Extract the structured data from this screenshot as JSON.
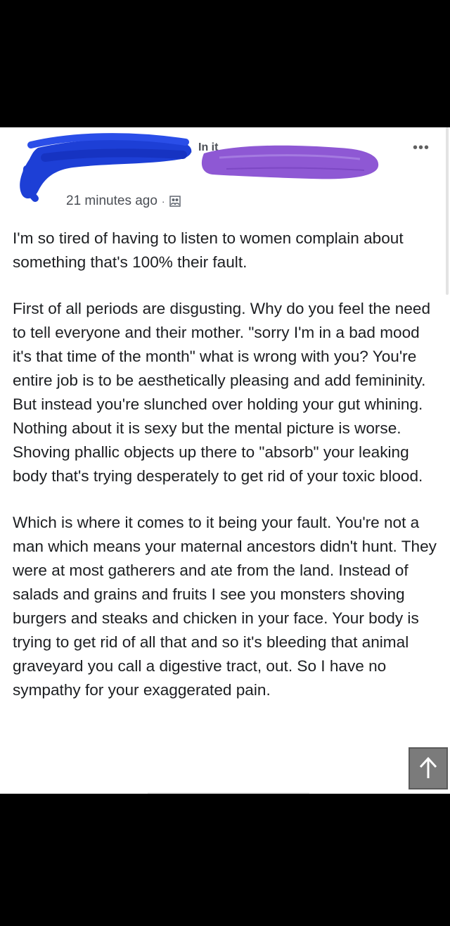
{
  "post": {
    "header": {
      "group_name_fragment": "In it",
      "timestamp": "21 minutes ago",
      "separator": "·",
      "privacy_icon": "group-members-icon",
      "more_icon": "more-options-icon"
    },
    "paragraphs": [
      "I'm so tired of having to listen to women complain about something that's 100% their fault.",
      "First of all periods are disgusting. Why do you feel the need to tell everyone and their mother. \"sorry I'm in a bad mood it's that time of the month\" what is wrong with you? You're entire job is to be aesthetically pleasing and add femininity. But instead you're slunched over holding your gut whining. Nothing about it is sexy but the mental picture is worse. Shoving phallic objects up there to \"absorb\" your leaking body that's trying desperately to get rid of your toxic blood.",
      "Which is where it comes to it being your fault. You're not a man which means your maternal ancestors didn't hunt. They were at most gatherers and ate from the land. Instead of salads and grains and fruits I see you monsters shoving burgers and steaks and chicken in your face. Your body is trying to get rid of all that and so it's bleeding that animal graveyard you call a digestive tract, out. So I have no sympathy for your exaggerated pain."
    ]
  },
  "overlay": {
    "scroll_top_icon": "arrow-up-icon"
  },
  "colors": {
    "background": "#000000",
    "card": "#ffffff",
    "text": "#1c1e21",
    "meta_text": "#4b4f56",
    "redaction_blue": "#1d3fd6",
    "redaction_purple": "#8e58d4",
    "scroll_button": "#7b7b7b"
  }
}
